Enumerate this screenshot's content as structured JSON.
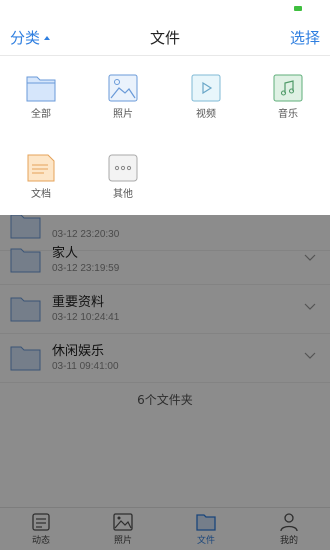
{
  "header": {
    "category_label": "分类",
    "title": "文件",
    "select_label": "选择"
  },
  "categories": [
    {
      "label": "全部",
      "icon": "folder-icon"
    },
    {
      "label": "照片",
      "icon": "image-icon"
    },
    {
      "label": "视频",
      "icon": "video-play-icon"
    },
    {
      "label": "音乐",
      "icon": "music-note-icon"
    },
    {
      "label": "文档",
      "icon": "document-icon"
    },
    {
      "label": "其他",
      "icon": "more-dots-icon"
    }
  ],
  "folders": [
    {
      "name": "",
      "date": "03-12 23:20:30"
    },
    {
      "name": "家人",
      "date": "03-12 23:19:59"
    },
    {
      "name": "重要资料",
      "date": "03-12 10:24:41"
    },
    {
      "name": "休闲娱乐",
      "date": "03-11 09:41:00"
    }
  ],
  "folder_count": "6个文件夹",
  "tabs": [
    {
      "label": "动态",
      "icon": "activity-icon"
    },
    {
      "label": "照片",
      "icon": "photo-icon"
    },
    {
      "label": "文件",
      "icon": "folder-icon"
    },
    {
      "label": "我的",
      "icon": "profile-icon"
    }
  ],
  "colors": {
    "accent": "#2f7fe0",
    "folder_fill": "#d6e6fb",
    "overlay": "rgba(0,0,0,0.45)"
  }
}
